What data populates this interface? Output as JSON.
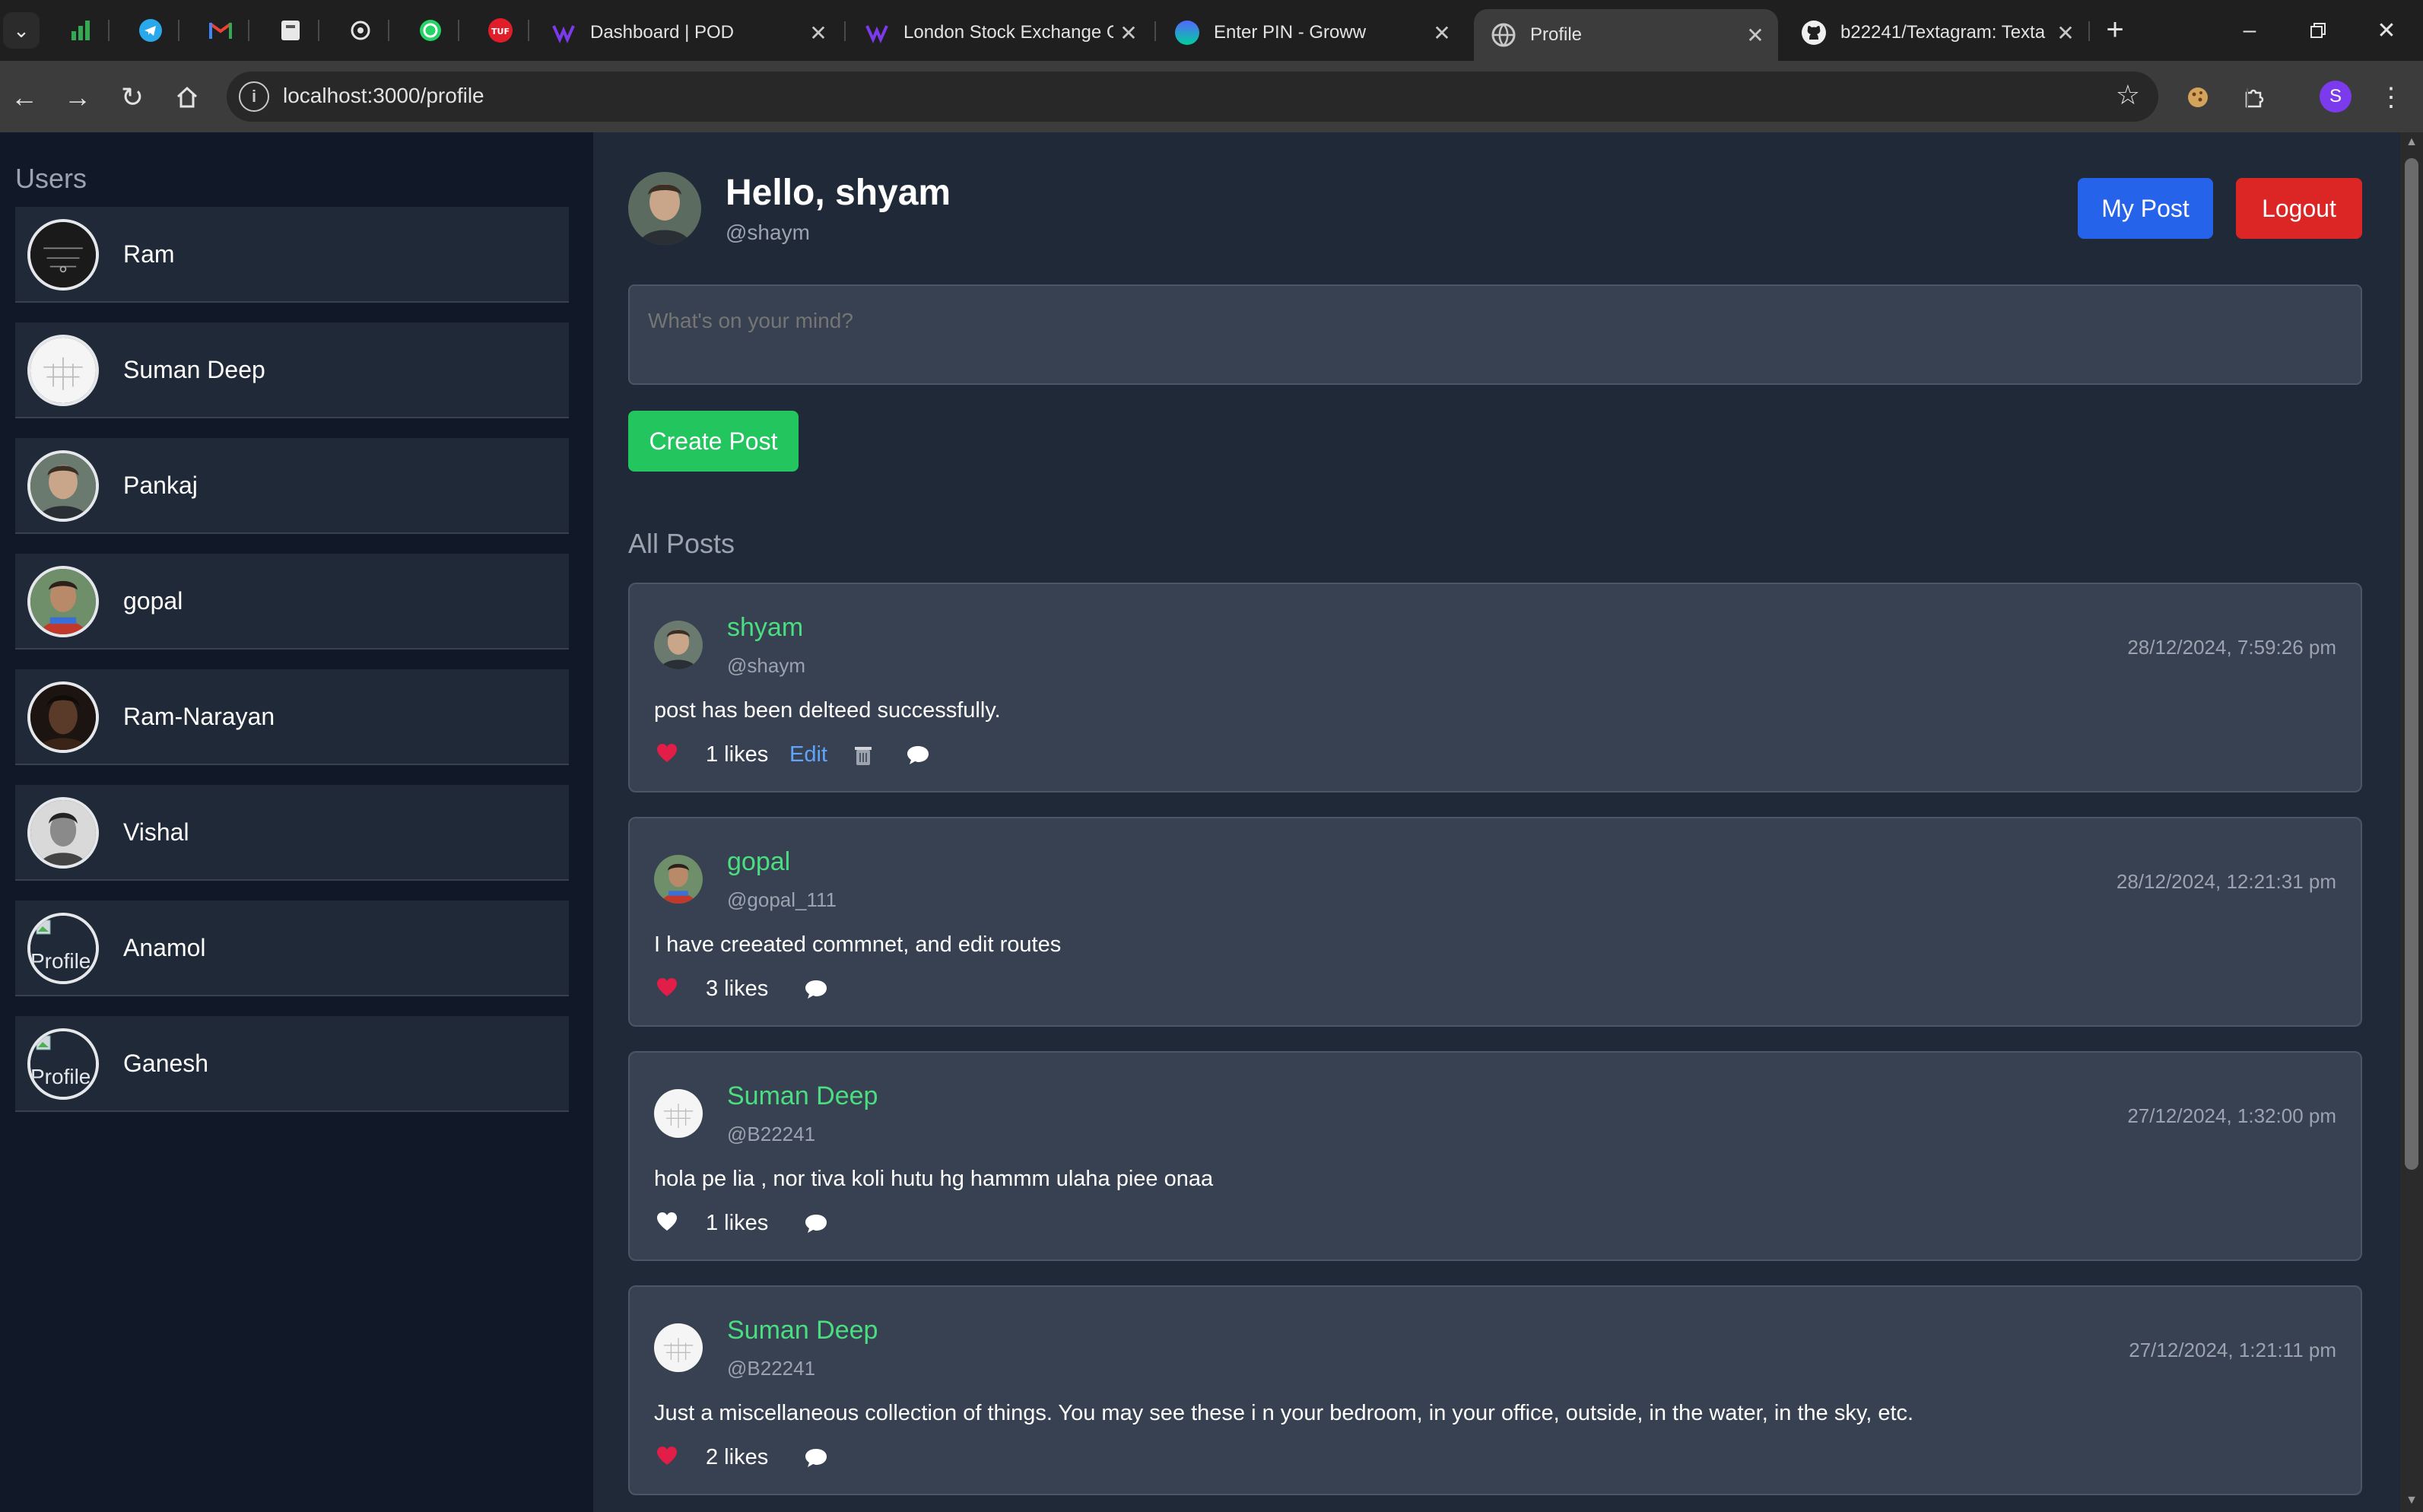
{
  "browser": {
    "pinned_tabs": [
      "analytics-icon",
      "telegram-icon",
      "gmail-icon",
      "notes-icon",
      "openai-icon",
      "whatsapp-icon",
      "tuf-icon"
    ],
    "tabs": [
      {
        "title": "Dashboard | POD",
        "icon": "pod-icon",
        "active": false
      },
      {
        "title": "London Stock Exchange G",
        "icon": "pod-icon",
        "active": false
      },
      {
        "title": "Enter PIN - Groww",
        "icon": "groww-icon",
        "active": false
      },
      {
        "title": "Profile",
        "icon": "globe-icon",
        "active": true
      },
      {
        "title": "b22241/Textagram: Texta",
        "icon": "github-icon",
        "active": false
      }
    ],
    "new_tab": "+",
    "url": "localhost:3000/profile",
    "profile_initial": "S"
  },
  "sidebar": {
    "title": "Users",
    "users": [
      {
        "name": "Ram",
        "avatar": "dark-sketch"
      },
      {
        "name": "Suman Deep",
        "avatar": "white-sketch"
      },
      {
        "name": "Pankaj",
        "avatar": "photo-face"
      },
      {
        "name": "gopal",
        "avatar": "photo-boy"
      },
      {
        "name": "Ram-Narayan",
        "avatar": "photo-dark"
      },
      {
        "name": "Vishal",
        "avatar": "photo-bw"
      },
      {
        "name": "Anamol",
        "avatar": "broken",
        "alt": "Profile"
      },
      {
        "name": "Ganesh",
        "avatar": "broken",
        "alt": "Profile"
      }
    ]
  },
  "header": {
    "greeting": "Hello, shyam",
    "handle": "@shaym",
    "my_post_label": "My Post",
    "logout_label": "Logout"
  },
  "composer": {
    "placeholder": "What's on your mind?",
    "create_label": "Create Post"
  },
  "posts_title": "All Posts",
  "posts": [
    {
      "name": "shyam",
      "handle": "@shaym",
      "date": "28/12/2024, 7:59:26 pm",
      "body": "post has been delteed successfully.",
      "likes": "1 likes",
      "liked": true,
      "edit": "Edit",
      "owner": true,
      "avatar": "photo-face"
    },
    {
      "name": "gopal",
      "handle": "@gopal_111",
      "date": "28/12/2024, 12:21:31 pm",
      "body": "I have creeated commnet, and edit routes",
      "likes": "3 likes",
      "liked": true,
      "owner": false,
      "avatar": "photo-boy"
    },
    {
      "name": "Suman Deep",
      "handle": "@B22241",
      "date": "27/12/2024, 1:32:00 pm",
      "body": "hola pe lia , nor tiva koli hutu hg hammm ulaha piee onaa",
      "likes": "1 likes",
      "liked": false,
      "owner": false,
      "avatar": "white-sketch"
    },
    {
      "name": "Suman Deep",
      "handle": "@B22241",
      "date": "27/12/2024, 1:21:11 pm",
      "body": "Just a miscellaneous collection of things. You may see these i n your bedroom, in your office, outside, in the water, in the sky, etc.",
      "likes": "2 likes",
      "liked": true,
      "owner": false,
      "avatar": "white-sketch"
    }
  ],
  "colors": {
    "accent_green": "#4ade80",
    "button_blue": "#2563eb",
    "button_red": "#dc2626",
    "button_green": "#22c55e",
    "heart_red": "#e11d48"
  }
}
